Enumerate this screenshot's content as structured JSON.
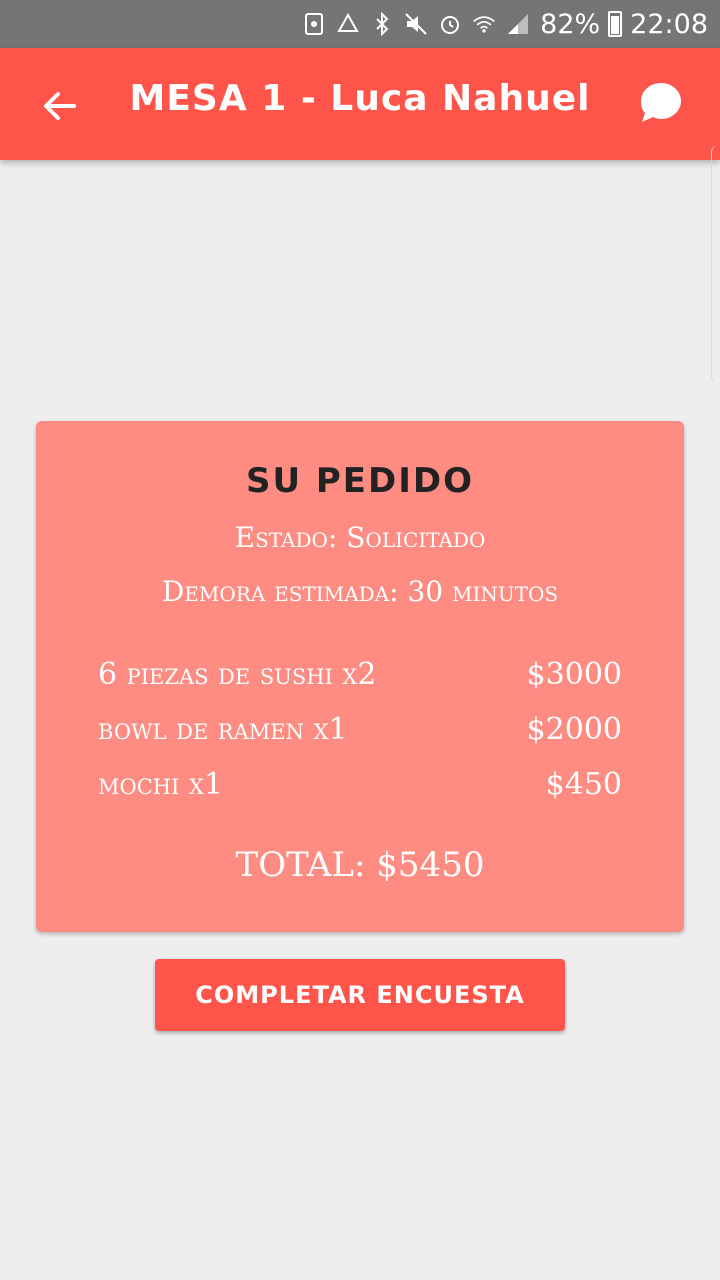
{
  "status_bar": {
    "battery": "82%",
    "time": "22:08",
    "icons": [
      "nfc-icon",
      "sync-icon",
      "bluetooth-icon",
      "mute-icon",
      "alarm-icon",
      "wifi-icon",
      "signal-icon",
      "battery-icon"
    ]
  },
  "app_bar": {
    "title": "MESA 1 - Luca Nahuel",
    "back_icon": "arrow-left-icon",
    "chat_icon": "chat-bubble-icon"
  },
  "order": {
    "title": "SU PEDIDO",
    "status": "Estado: Solicitado",
    "delay": "Demora estimada: 30 minutos",
    "items": [
      {
        "name": "6 piezas de sushi x2",
        "price": "$3000"
      },
      {
        "name": "bowl de ramen x1",
        "price": "$2000"
      },
      {
        "name": "mochi x1",
        "price": "$450"
      }
    ],
    "total": "TOTAL: $5450"
  },
  "survey_button": {
    "label": "COMPLETAR ENCUESTA"
  },
  "colors": {
    "primary": "#ff5449",
    "card": "#ff8c82",
    "status_bar": "#757575",
    "background": "#eeeeee"
  }
}
